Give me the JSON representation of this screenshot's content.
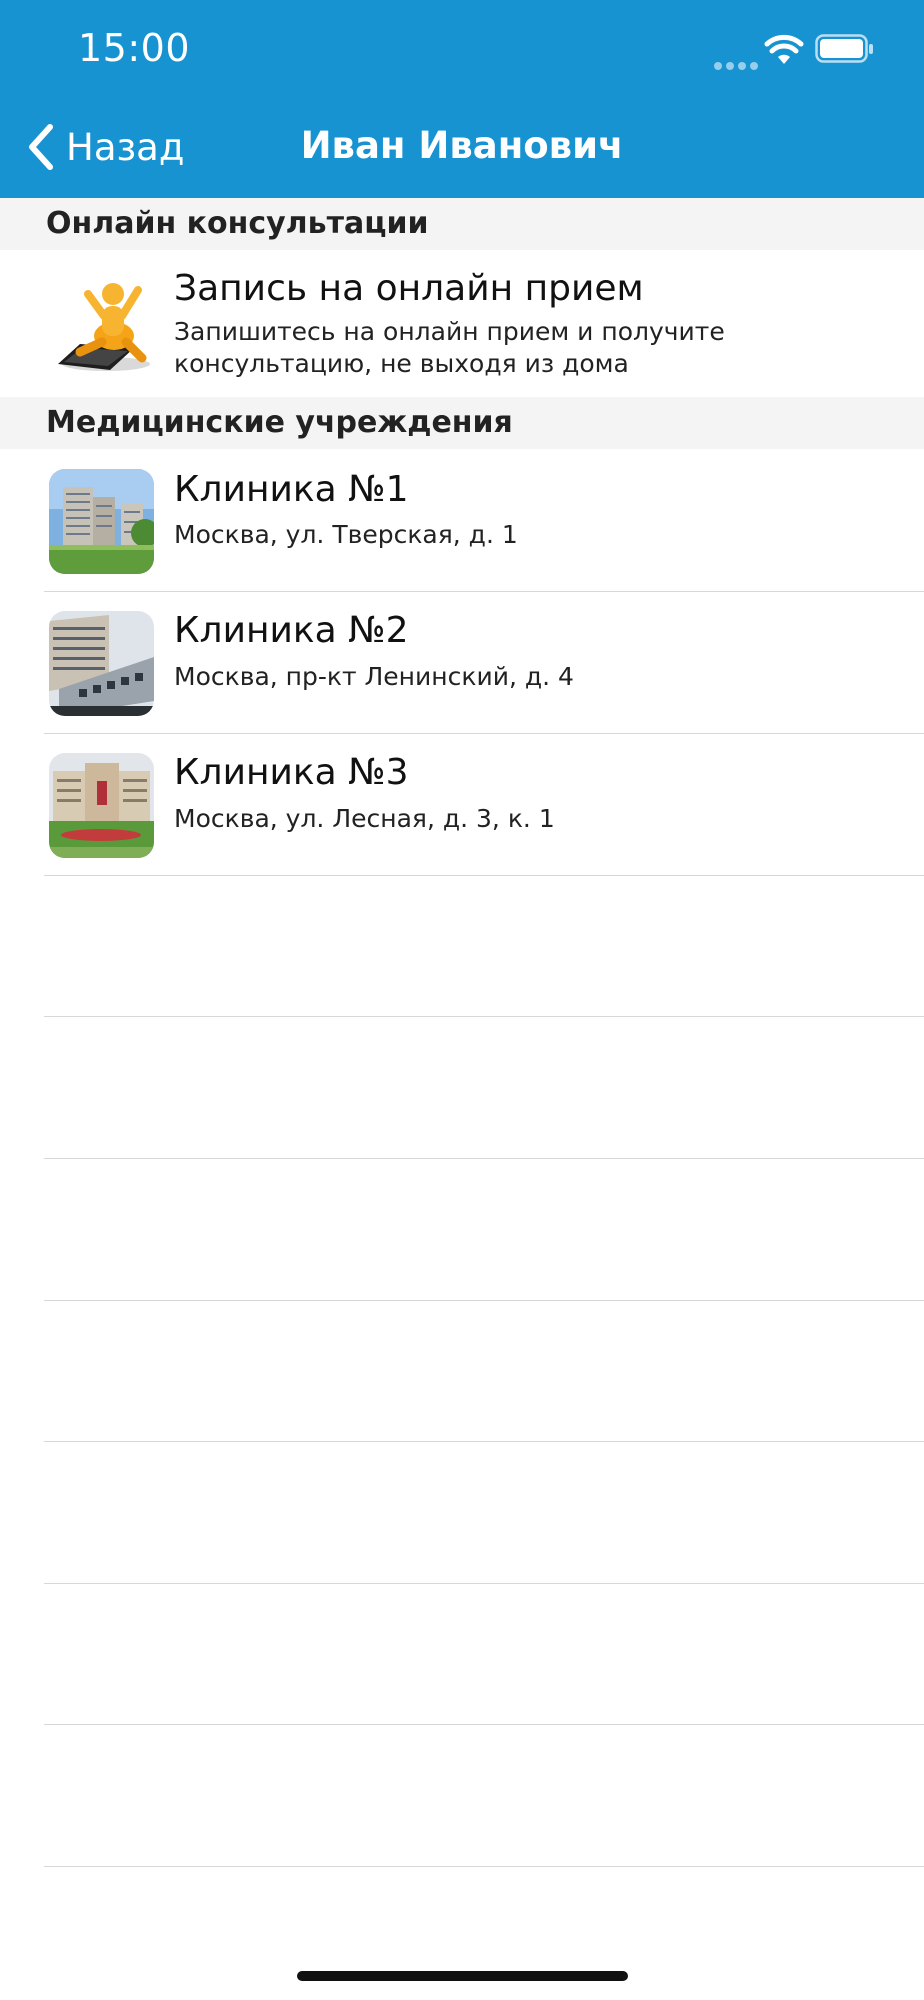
{
  "status_bar": {
    "time": "15:00"
  },
  "nav": {
    "back_label": "Назад",
    "title": "Иван Иванович"
  },
  "sections": {
    "online": {
      "header": "Онлайн консультации",
      "item": {
        "title": "Запись на онлайн прием",
        "subtitle_line1": "Запишитесь на онлайн прием и получите",
        "subtitle_line2": "консультацию, не выходя из дома",
        "icon": "online-consultation-icon"
      }
    },
    "clinics": {
      "header": "Медицинские учреждения",
      "items": [
        {
          "title": "Клиника №1",
          "address": "Москва, ул. Тверская, д. 1"
        },
        {
          "title": "Клиника №2",
          "address": "Москва, пр-кт Ленинский, д. 4"
        },
        {
          "title": "Клиника №3",
          "address": "Москва, ул. Лесная, д. 3, к. 1"
        }
      ]
    }
  },
  "colors": {
    "nav_bar": "#1893d2",
    "section_header_bg": "#f4f4f4",
    "separator": "#d8d8d8"
  }
}
